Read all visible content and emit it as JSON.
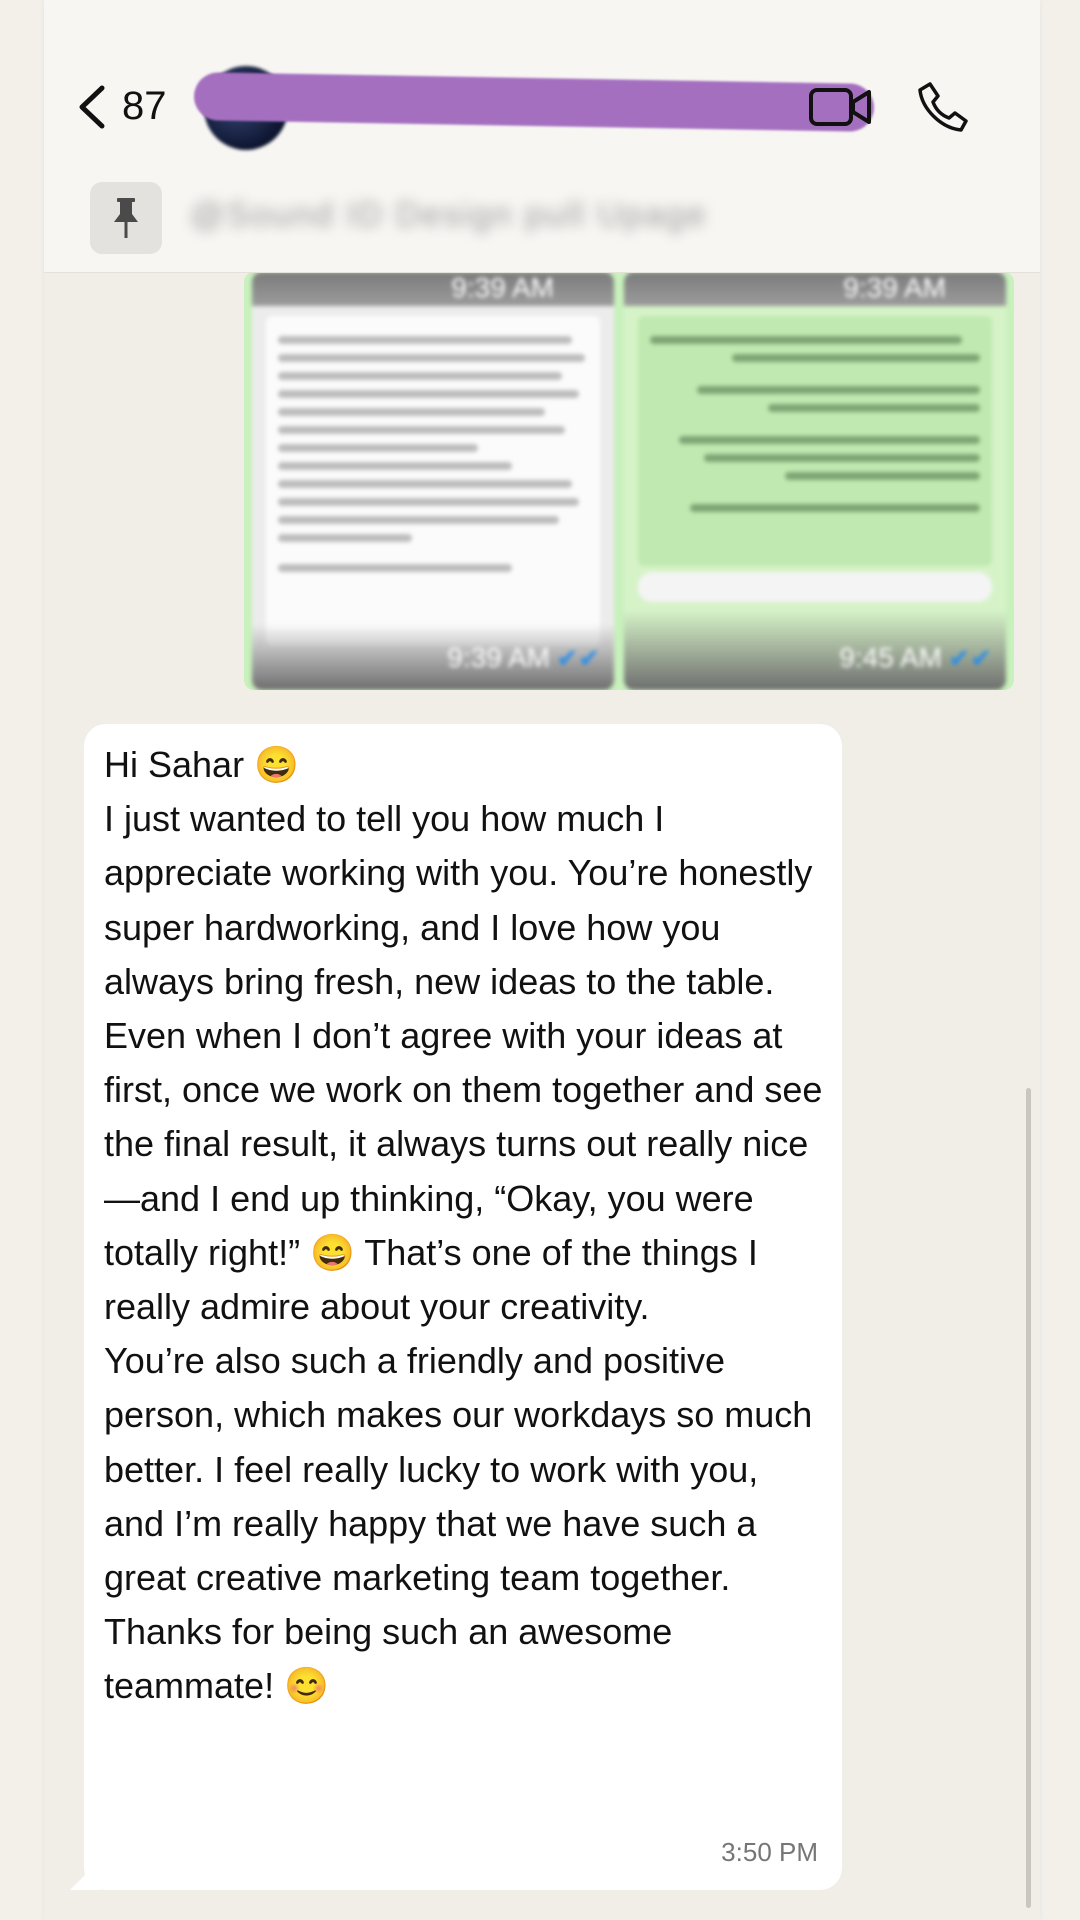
{
  "header": {
    "unread_count": "87",
    "contact_name": "",
    "pinned_message_preview": "@Sound ID Design pull Upage"
  },
  "icons": {
    "back": "chevron-left-icon",
    "video": "video-camera-icon",
    "call": "phone-icon",
    "pin": "pin-icon"
  },
  "image_message": {
    "tiles": [
      {
        "time": "9:39 AM",
        "status": "read"
      },
      {
        "time": "9:45 AM",
        "status": "read"
      }
    ],
    "top_times": [
      "9:39 AM",
      "9:39 AM"
    ]
  },
  "message": {
    "text": "Hi Sahar 😄\nI just wanted to tell you how much I appreciate working with you. You’re honestly super hardworking, and I love how you always bring fresh, new ideas to the table.\nEven when I don’t agree with your ideas at first, once we work on them together and see the final result, it always turns out really nice—and I end up thinking, “Okay, you were totally right!” 😄 That’s one of the things I really admire about your creativity.\nYou’re also such a friendly and positive person, which makes our workdays so much better. I feel really lucky to work with you, and I’m really happy that we have such a great creative marketing team together.\nThanks for being such an awesome teammate! 😊",
    "time": "3:50 PM"
  },
  "colors": {
    "background": "#f1eee8",
    "outgoing_bubble": "#c8f1bd",
    "incoming_bubble": "#ffffff",
    "redaction": "#a56fc0",
    "read_check": "#2b8ee8"
  }
}
